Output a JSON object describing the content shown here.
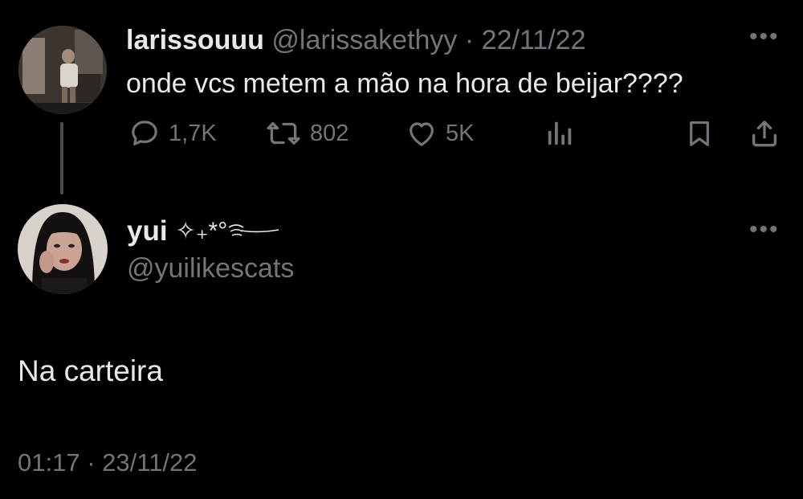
{
  "parent_tweet": {
    "display_name": "larissouuu",
    "handle": "@larissakethyy",
    "separator": "·",
    "date": "22/11/22",
    "text": "onde vcs metem a mão na hora de beijar????",
    "more_icon": "more-dots-icon",
    "actions": {
      "reply_count": "1,7K",
      "retweet_count": "802",
      "like_count": "5K",
      "reply_icon": "reply-bubble-icon",
      "retweet_icon": "retweet-icon",
      "like_icon": "heart-icon",
      "views_icon": "analytics-bars-icon",
      "bookmark_icon": "bookmark-icon",
      "share_icon": "share-upload-icon"
    }
  },
  "reply_tweet": {
    "display_name": "yui",
    "name_decoration": "✧₊*°",
    "handle": "@yuilikescats",
    "text": "Na carteira",
    "time": "01:17",
    "separator": "·",
    "date": "23/11/22",
    "more_icon": "more-dots-icon"
  },
  "colors": {
    "background": "#000000",
    "primary_text": "#e7e9ea",
    "secondary_text": "#71767b",
    "thread_line": "#4a4d50"
  }
}
